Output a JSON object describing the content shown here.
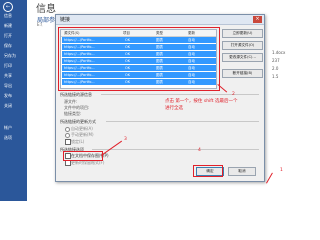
{
  "nav": {
    "back": "←",
    "items": [
      "信息",
      "新建",
      "打开",
      "保存",
      "另存为",
      "打印",
      "共享",
      "导出",
      "发布",
      "关闭",
      "帐户",
      "选项"
    ]
  },
  "backstage": {
    "title": "信息",
    "subtitle": "局部参...",
    "path": "E:\\",
    "side_lines": [
      "1.docx",
      "237",
      "2.0",
      "1.5",
      "",
      ""
    ]
  },
  "dialog": {
    "title": "链接",
    "close": "×",
    "table": {
      "headers": [
        "源文件(S)",
        "项目",
        "类型",
        "更新"
      ],
      "rows": [
        [
          "https://...\\Portfo...",
          "OK",
          "图表",
          "自动"
        ],
        [
          "https://...\\Portfo...",
          "OK",
          "图表",
          "自动"
        ],
        [
          "https://...\\Portfo...",
          "OK",
          "图表",
          "自动"
        ],
        [
          "https://...\\Portfo...",
          "OK",
          "图表",
          "自动"
        ],
        [
          "https://...\\Portfo...",
          "OK",
          "图表",
          "自动"
        ],
        [
          "https://...\\Portfo...",
          "OK",
          "图表",
          "自动"
        ],
        [
          "https://...\\Portfo...",
          "OK",
          "图表",
          "自动"
        ]
      ]
    },
    "buttons": {
      "update_now": "立即更新(U)",
      "open_source": "打开源文件(O)",
      "change_source": "更改源文件(C)...",
      "break_link": "断开链接(B)",
      "ok": "确定",
      "cancel": "取消"
    },
    "sections": {
      "source_info": "所选链接的源信息",
      "source_file_label": "源文件:",
      "source_item_label": "文件中的项目:",
      "link_type_label": "链接类型:",
      "update_method": "所选链接的更新方式",
      "auto_update": "自动更新(A)",
      "manual_update": "手动更新(M)",
      "lock": "锁定(L)",
      "options": "所选链接选项",
      "save_picture": "在文档中保存图片(P)",
      "preserve_format": "更新时保留格式(F)"
    }
  },
  "annotations": {
    "n1": "1",
    "n2": "2",
    "n3": "3",
    "n4": "4",
    "note_line1": "点击 第一个，按住 shift 选最后一个",
    "note_line2": "进行全选"
  },
  "colors": {
    "nav_bg": "#2b579a",
    "selection": "#3399ff",
    "annotation": "#e0202a"
  }
}
